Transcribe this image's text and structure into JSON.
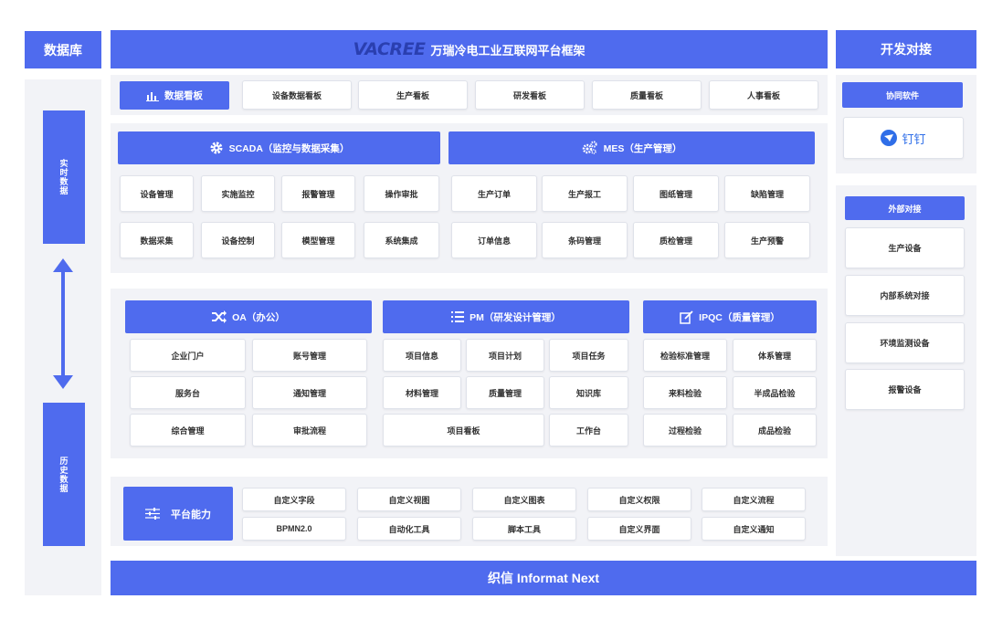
{
  "left": {
    "title": "数据库",
    "top_label": "实时数据",
    "bottom_label": "历史数据"
  },
  "header": {
    "logo_text": "VACREE",
    "title": "万瑞冷电工业互联网平台框架"
  },
  "right": {
    "title": "开发对接",
    "collab_header": "协同软件",
    "collab_item": "钉钉",
    "external_header": "外部对接",
    "external_items": [
      "生产设备",
      "内部系统对接",
      "环境监测设备",
      "报警设备"
    ]
  },
  "dashboard": {
    "title": "数据看板",
    "items": [
      "设备数据看板",
      "生产看板",
      "研发看板",
      "质量看板",
      "人事看板"
    ]
  },
  "scada": {
    "title": "SCADA（监控与数据采集）",
    "items": [
      "设备管理",
      "实施监控",
      "报警管理",
      "操作审批",
      "数据采集",
      "设备控制",
      "模型管理",
      "系统集成"
    ]
  },
  "mes": {
    "title": "MES（生产管理）",
    "items": [
      "生产订单",
      "生产报工",
      "图纸管理",
      "缺陷管理",
      "订单信息",
      "条码管理",
      "质检管理",
      "生产预警"
    ]
  },
  "oa": {
    "title": "OA（办公）",
    "items": [
      "企业门户",
      "账号管理",
      "服务台",
      "通知管理",
      "综合管理",
      "审批流程"
    ]
  },
  "pm": {
    "title": "PM（研发设计管理）",
    "items": [
      "项目信息",
      "项目计划",
      "项目任务",
      "材料管理",
      "质量管理",
      "知识库",
      "项目看板",
      "工作台"
    ]
  },
  "ipqc": {
    "title": "IPQC（质量管理）",
    "items": [
      "检验标准管理",
      "体系管理",
      "来料检验",
      "半成品检验",
      "过程检验",
      "成品检验"
    ]
  },
  "platform": {
    "title": "平台能力",
    "items": [
      "自定义字段",
      "自定义视图",
      "自定义图表",
      "自定义权限",
      "自定义流程",
      "BPMN2.0",
      "自动化工具",
      "脚本工具",
      "自定义界面",
      "自定义通知"
    ]
  },
  "footer": {
    "title": "织信 Informat Next"
  },
  "colors": {
    "accent": "#4f6bee",
    "panel": "#f2f3f7"
  }
}
